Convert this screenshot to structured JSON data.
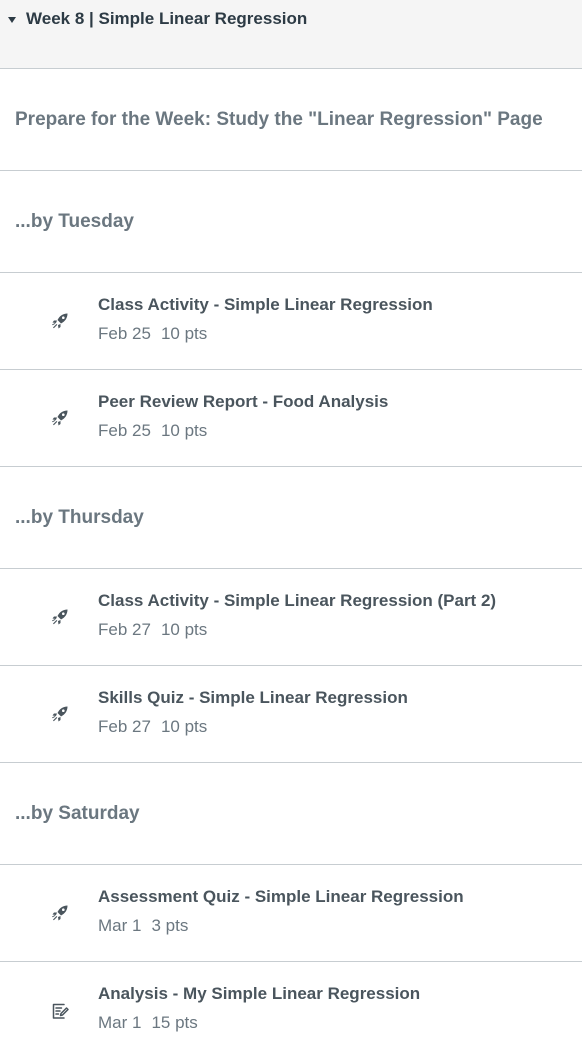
{
  "module": {
    "title": "Week 8 | Simple Linear Regression"
  },
  "intro": {
    "label": "Prepare for the Week: Study the \"Linear Regression\" Page"
  },
  "sections": [
    {
      "label": "...by Tuesday"
    },
    {
      "label": "...by Thursday"
    },
    {
      "label": "...by Saturday"
    }
  ],
  "items": [
    {
      "icon": "rocket-icon",
      "title": "Class Activity - Simple Linear Regression",
      "date": "Feb 25",
      "points": "10 pts"
    },
    {
      "icon": "rocket-icon",
      "title": "Peer Review Report - Food Analysis",
      "date": "Feb 25",
      "points": "10 pts"
    },
    {
      "icon": "rocket-icon",
      "title": "Class Activity - Simple Linear Regression (Part 2)",
      "date": "Feb 27",
      "points": "10 pts"
    },
    {
      "icon": "rocket-icon",
      "title": "Skills Quiz - Simple Linear Regression",
      "date": "Feb 27",
      "points": "10 pts"
    },
    {
      "icon": "rocket-icon",
      "title": "Assessment Quiz - Simple Linear Regression",
      "date": "Mar 1",
      "points": "3 pts"
    },
    {
      "icon": "assignment-icon",
      "title": "Analysis - My Simple Linear Regression",
      "date": "Mar 1",
      "points": "15 pts"
    }
  ]
}
